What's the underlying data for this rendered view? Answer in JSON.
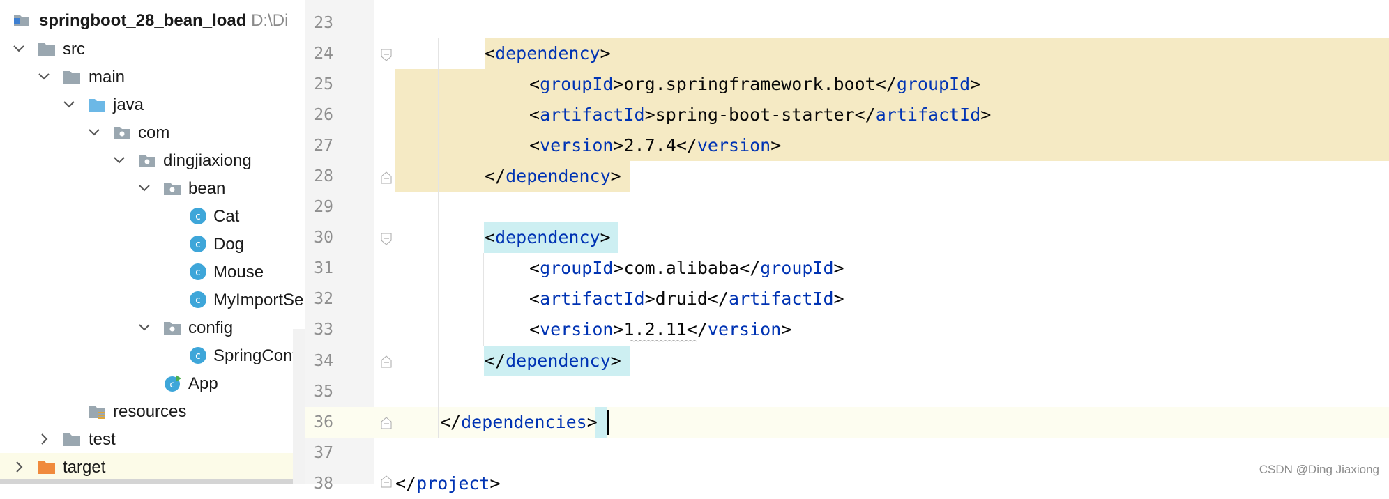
{
  "project_tree": {
    "root": {
      "label": "springboot_28_bean_load",
      "path": "D:\\Di"
    },
    "items": [
      {
        "label": "src",
        "icon": "folder-icon"
      },
      {
        "label": "main",
        "icon": "folder-icon"
      },
      {
        "label": "java",
        "icon": "source-folder-icon"
      },
      {
        "label": "com",
        "icon": "package-icon"
      },
      {
        "label": "dingjiaxiong",
        "icon": "package-icon"
      },
      {
        "label": "bean",
        "icon": "package-icon"
      },
      {
        "label": "Cat",
        "icon": "class-icon"
      },
      {
        "label": "Dog",
        "icon": "class-icon"
      },
      {
        "label": "Mouse",
        "icon": "class-icon"
      },
      {
        "label": "MyImportSe",
        "icon": "class-icon"
      },
      {
        "label": "config",
        "icon": "package-icon"
      },
      {
        "label": "SpringConf",
        "icon": "class-icon"
      },
      {
        "label": "App",
        "icon": "spring-boot-class-icon"
      },
      {
        "label": "resources",
        "icon": "resources-folder-icon"
      },
      {
        "label": "test",
        "icon": "folder-icon"
      },
      {
        "label": "target",
        "icon": "excluded-folder-icon"
      }
    ]
  },
  "editor": {
    "line_numbers": [
      "23",
      "24",
      "25",
      "26",
      "27",
      "28",
      "29",
      "30",
      "31",
      "32",
      "33",
      "34",
      "35",
      "36",
      "37",
      "38"
    ],
    "lines": {
      "l24": {
        "tag": "dependency"
      },
      "l25": {
        "tag": "groupId",
        "value": "org.springframework.boot"
      },
      "l26": {
        "tag": "artifactId",
        "value": "spring-boot-starter"
      },
      "l27": {
        "tag": "version",
        "value": "2.7.4"
      },
      "l28": {
        "tag": "dependency"
      },
      "l30": {
        "tag": "dependency"
      },
      "l31": {
        "tag": "groupId",
        "value": "com.alibaba"
      },
      "l32": {
        "tag": "artifactId",
        "value": "druid"
      },
      "l33": {
        "tag": "version",
        "value": "1.2.11"
      },
      "l34": {
        "tag": "dependency"
      },
      "l36": {
        "tag": "dependencies"
      },
      "l38": {
        "tag": "project"
      }
    }
  },
  "symbols": {
    "lt": "<",
    "gt": ">",
    "lt_slash": "</"
  },
  "watermark": "CSDN @Ding Jiaxiong",
  "colors": {
    "tag": "#0033b3",
    "highlight_yellow": "#f5eac4",
    "highlight_cyan": "#cdeff2",
    "class_icon": "#3ea6d9"
  }
}
